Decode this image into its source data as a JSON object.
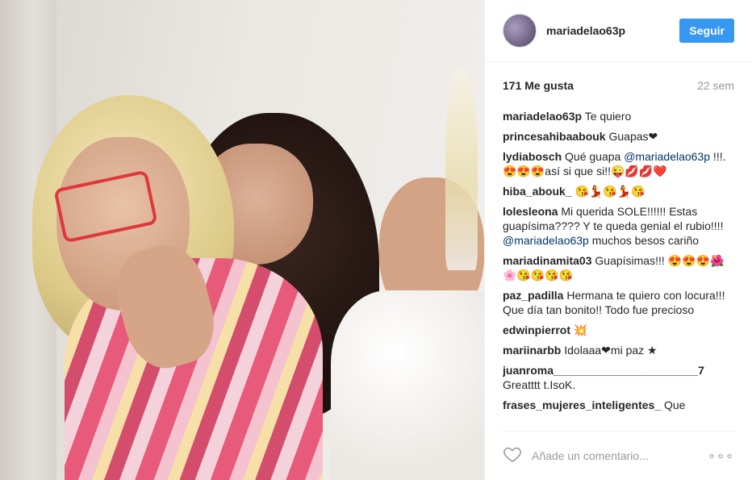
{
  "post": {
    "username": "mariadelao63p",
    "follow_label": "Seguir",
    "likes": "171 Me gusta",
    "time": "22 sem",
    "add_comment_placeholder": "Añade un comentario...",
    "more_icon": "more-dots-icon"
  },
  "comments": [
    {
      "user": "mariadelao63p",
      "text": "Te quiero"
    },
    {
      "user": "princesahibaabouk",
      "text": "Guapas❤"
    },
    {
      "user": "lydiabosch",
      "pre": "Qué guapa ",
      "mention": "@mariadelao63p",
      "text": " !!!. 😍😍😍así si que si!!😜💋💋❤️"
    },
    {
      "user": "hiba_abouk_",
      "text": "😘💃😘💃😘"
    },
    {
      "user": "lolesleona",
      "pre": "Mi querida SOLE!!!!!! Estas guapísima???? Y te queda genial el rubio!!!! ",
      "mention": "@mariadelao63p",
      "text": " muchos besos cariño"
    },
    {
      "user": "mariadinamita03",
      "text": "Guapísimas!!! 😍😍😍🌺🌸😘😘😘😘"
    },
    {
      "user": "paz_padilla",
      "text": "Hermana te quiero con locura!!! Que día tan bonito!! Todo fue precioso"
    },
    {
      "user": "edwinpierrot",
      "text": "💥"
    },
    {
      "user": "mariinarbb",
      "text": "Idolaaa❤mi paz ★"
    },
    {
      "user": "juanroma_______________________7",
      "text": "Greatttt t.IsoK."
    },
    {
      "user": "frases_mujeres_inteligentes_",
      "text": "Que"
    }
  ],
  "colors": {
    "follow_bg": "#3897f0",
    "mention": "#003569",
    "muted": "#999999"
  }
}
